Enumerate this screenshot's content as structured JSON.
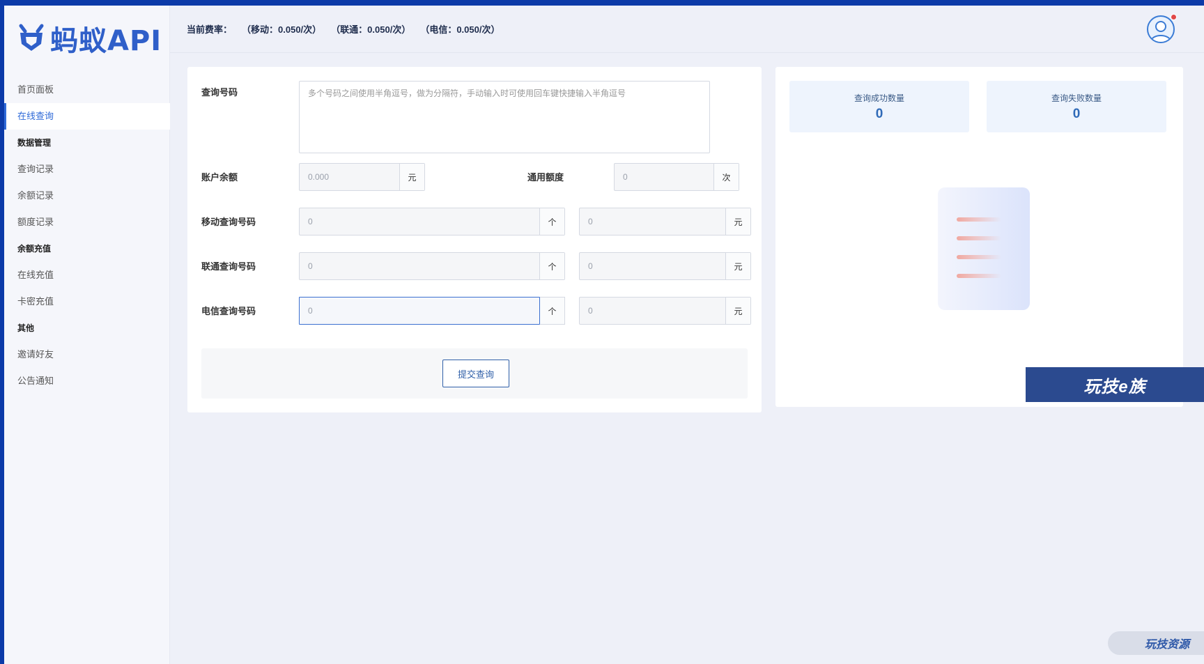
{
  "app": {
    "logo_text": "蚂蚁API"
  },
  "header": {
    "rate_label": "当前费率：",
    "rate_mobile": "（移动：0.050/次）",
    "rate_unicom": "（联通：0.050/次）",
    "rate_telecom": "（电信：0.050/次）"
  },
  "sidebar": {
    "home": "首页面板",
    "online_query": "在线查询",
    "group_data": "数据管理",
    "query_records": "查询记录",
    "balance_records": "余额记录",
    "quota_records": "额度记录",
    "group_recharge": "余额充值",
    "online_recharge": "在线充值",
    "card_recharge": "卡密充值",
    "group_other": "其他",
    "invite": "邀请好友",
    "notice": "公告通知"
  },
  "form": {
    "numbers_label": "查询号码",
    "numbers_placeholder": "多个号码之间使用半角逗号，做为分隔符，手动输入时可使用回车键快捷输入半角逗号",
    "balance_label": "账户余额",
    "balance_placeholder": "0.000",
    "balance_unit": "元",
    "quota_label": "通用额度",
    "quota_placeholder": "0",
    "quota_unit": "次",
    "mobile_label": "移动查询号码",
    "unicom_label": "联通查询号码",
    "telecom_label": "电信查询号码",
    "count_placeholder": "0",
    "count_unit": "个",
    "cost_placeholder": "0",
    "cost_unit": "元",
    "submit_label": "提交查询"
  },
  "stats": {
    "success_label": "查询成功数量",
    "success_value": "0",
    "fail_label": "查询失败数量",
    "fail_value": "0"
  },
  "watermarks": {
    "top": "玩技e族",
    "bottom": "玩技资源"
  },
  "colors": {
    "accent": "#2f6ad8",
    "frame": "#0c3aa8",
    "background": "#eef0f8",
    "stat_bg": "#eef4fd"
  },
  "icons": {
    "logo": "ant-logo-icon",
    "avatar": "user-avatar-icon",
    "empty": "empty-document-icon"
  }
}
